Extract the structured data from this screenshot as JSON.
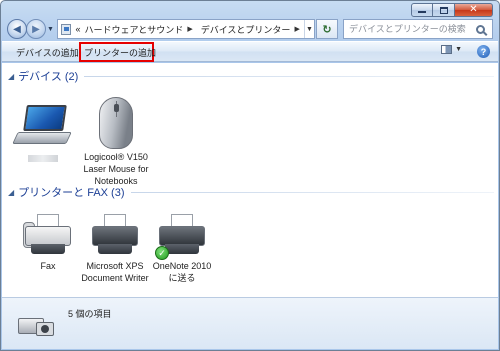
{
  "window": {
    "address_prefix": "«",
    "breadcrumb": [
      "ハードウェアとサウンド",
      "デバイスとプリンター"
    ],
    "search_placeholder": "デバイスとプリンターの検索"
  },
  "toolbar": {
    "add_device": "デバイスの追加",
    "add_printer": "プリンターの追加"
  },
  "groups": [
    {
      "title": "デバイス (2)",
      "items": [
        {
          "icon": "laptop-icon",
          "label": ""
        },
        {
          "icon": "mouse-icon",
          "label": "Logicool® V150 Laser Mouse for Notebooks"
        }
      ]
    },
    {
      "title": "プリンターと FAX (3)",
      "items": [
        {
          "icon": "fax-icon",
          "label": "Fax"
        },
        {
          "icon": "printer-icon",
          "label": "Microsoft XPS Document Writer"
        },
        {
          "icon": "default-printer-icon",
          "label": "OneNote 2010 に送る",
          "is_default": true
        }
      ]
    }
  ],
  "details": {
    "item_count_text": "5 個の項目"
  },
  "colors": {
    "highlight_box": "#e60000",
    "group_title": "#1c3f95"
  }
}
